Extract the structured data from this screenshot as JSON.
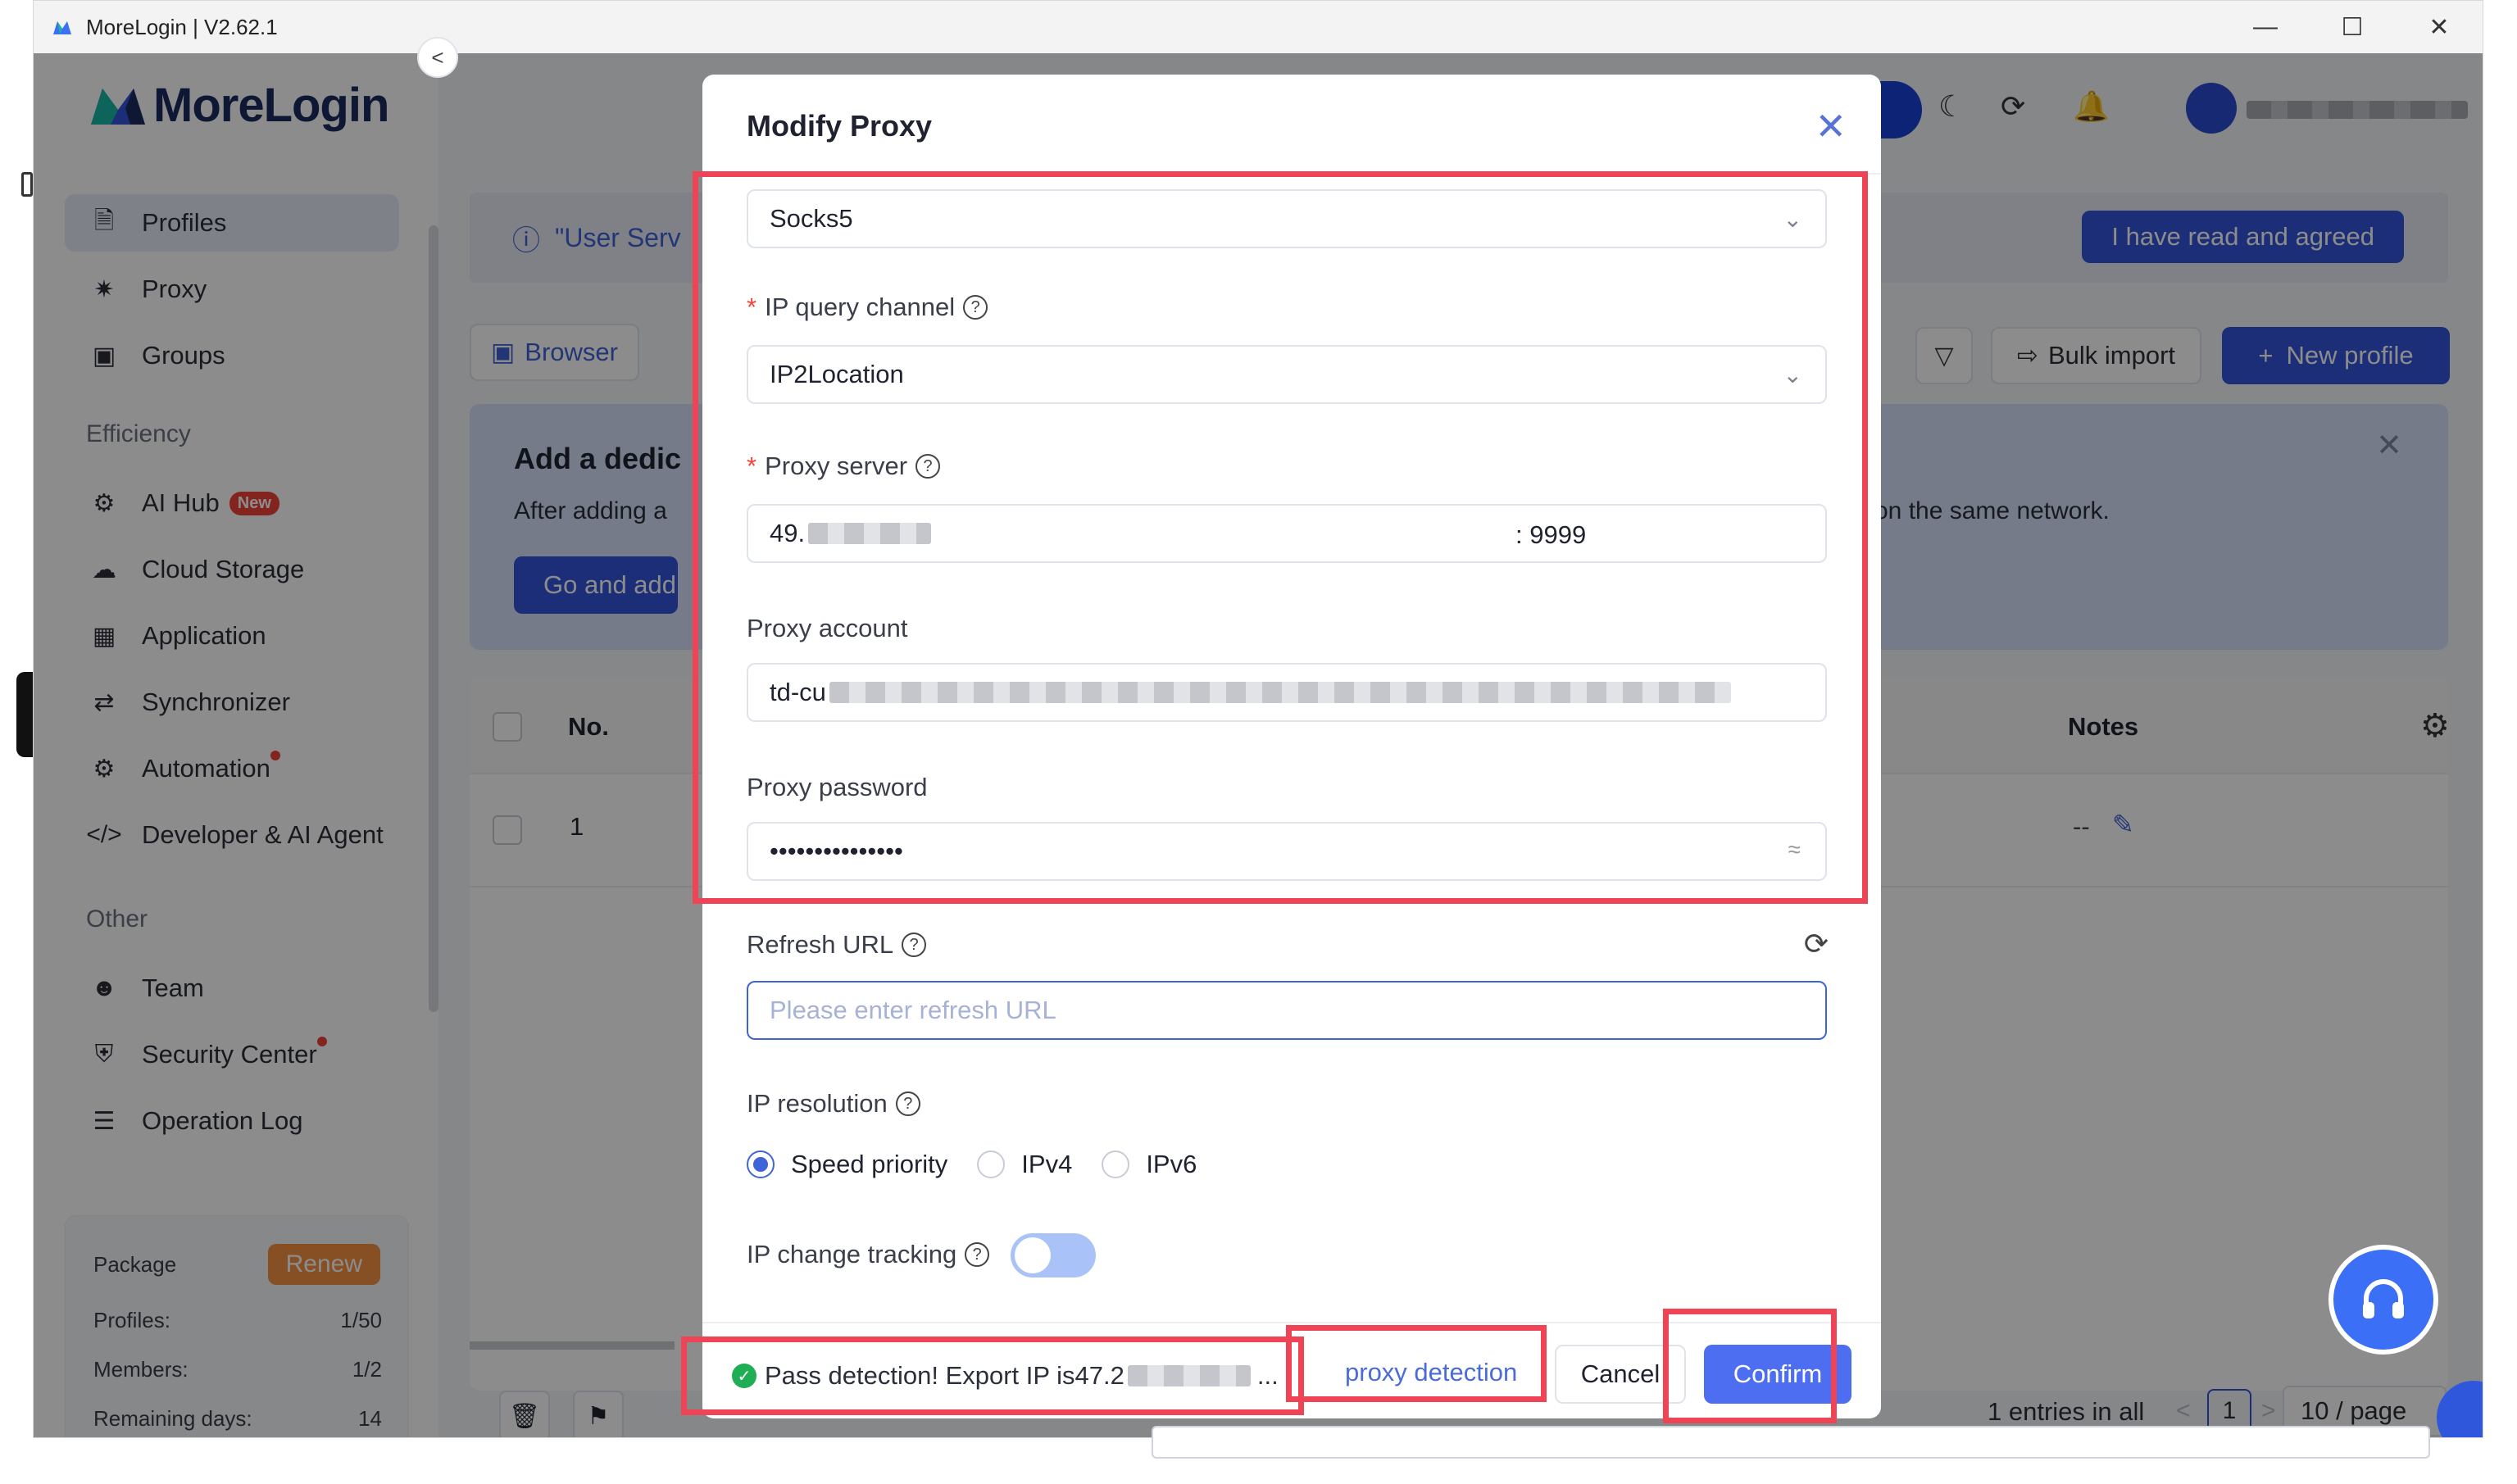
{
  "window": {
    "title": "MoreLogin | V2.62.1"
  },
  "brand": {
    "name": "MoreLogin",
    "accent": "#3255d9",
    "highlight": "#ee4455"
  },
  "sidebar": {
    "main_items": [
      {
        "label": "Profiles",
        "icon": "file-icon"
      },
      {
        "label": "Proxy",
        "icon": "proxy-icon"
      },
      {
        "label": "Groups",
        "icon": "groups-icon"
      }
    ],
    "efficiency_title": "Efficiency",
    "efficiency_items": [
      {
        "label": "AI Hub",
        "badge": "New"
      },
      {
        "label": "Cloud Storage"
      },
      {
        "label": "Application"
      },
      {
        "label": "Synchronizer"
      },
      {
        "label": "Automation"
      },
      {
        "label": "Developer & AI Agent"
      }
    ],
    "other_title": "Other",
    "other_items": [
      {
        "label": "Team"
      },
      {
        "label": "Security Center"
      },
      {
        "label": "Operation Log"
      }
    ],
    "package": {
      "title": "Package",
      "renew": "Renew",
      "profiles_label": "Profiles:",
      "profiles_value": "1/50",
      "members_label": "Members:",
      "members_value": "1/2",
      "days_label": "Remaining days:",
      "days_value": "14"
    }
  },
  "main": {
    "notice_text": "\"User Serv",
    "agree_button": "I have read and agreed",
    "tab_browser": "Browser",
    "bulk_import": "Bulk import",
    "new_profile": "New profile",
    "promo_title": "Add a dedic",
    "promo_desc": "After adding a",
    "promo_desc_end": "on the same network.",
    "promo_button": "Go and add",
    "table": {
      "col_no": "No.",
      "col_notes": "Notes",
      "row_no": "1",
      "row_notes": "--"
    },
    "pagination": {
      "entries": "1 entries in all",
      "page": "1",
      "page_size": "10 / page"
    }
  },
  "modal": {
    "title": "Modify Proxy",
    "proxy_type": "Socks5",
    "ip_query_label": "IP query channel",
    "ip_query_value": "IP2Location",
    "proxy_server_label": "Proxy server",
    "proxy_server_host": "49.",
    "proxy_server_port": ": 9999",
    "proxy_account_label": "Proxy account",
    "proxy_account_value": "td-cu",
    "proxy_password_label": "Proxy password",
    "proxy_password_value": "•••••••••••••••",
    "refresh_url_label": "Refresh URL",
    "refresh_url_placeholder": "Please enter refresh URL",
    "ip_resolution_label": "IP resolution",
    "ip_resolution_options": [
      "Speed priority",
      "IPv4",
      "IPv6"
    ],
    "ip_resolution_selected": "Speed priority",
    "ip_change_label": "IP change tracking",
    "ip_change_enabled": false,
    "detect_message": "Pass detection! Export IP is47.2",
    "detect_ellipsis": "...",
    "proxy_detection": "proxy detection",
    "cancel": "Cancel",
    "confirm": "Confirm"
  }
}
